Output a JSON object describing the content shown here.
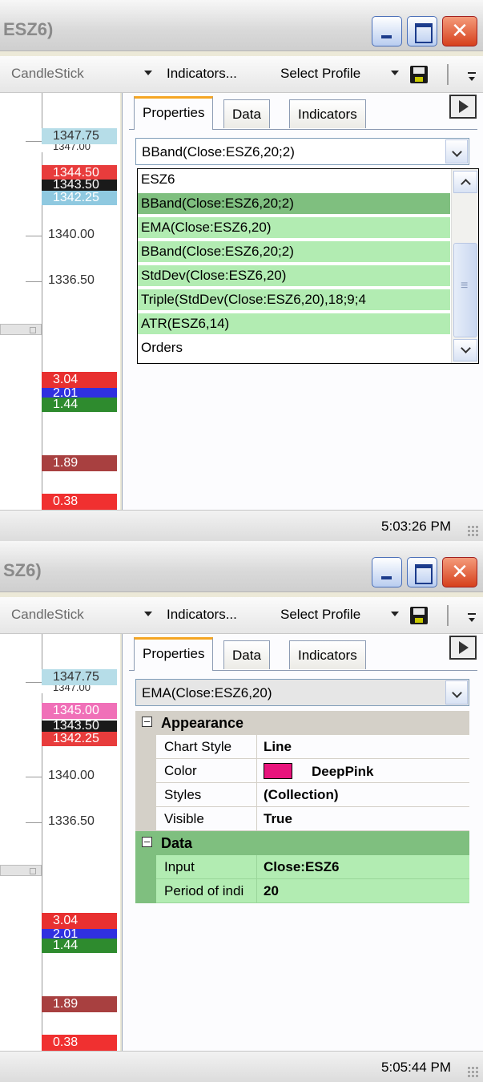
{
  "panels": [
    {
      "title": "SZ6)",
      "title_visible_prefix": "ESZ6)",
      "toolbar": {
        "chart_style": "CandleStick",
        "indicators": "Indicators...",
        "select_profile": "Select Profile"
      },
      "axis": {
        "top_box_back": "1347.00",
        "boxes": [
          {
            "text": "1347.75",
            "color": "#b6dde8"
          },
          {
            "text": "1344.50",
            "color": "#e83c3c"
          },
          {
            "text": "1343.50",
            "color": "#1a1a1a"
          },
          {
            "text": "1342.25",
            "color": "#8fc9e0"
          }
        ],
        "labels": [
          "1340.00",
          "1336.50"
        ],
        "indicator_boxes": [
          {
            "text": "3.04",
            "color": "#e83030"
          },
          {
            "text": "2.01",
            "color": "#3030e0"
          },
          {
            "text": "1.44",
            "color": "#2e8b2e"
          },
          {
            "text": "1.89",
            "color": "#a84040"
          },
          {
            "text": "0.38",
            "color": "#f03030"
          }
        ]
      },
      "tabs": [
        "Properties",
        "Data",
        "Indicators"
      ],
      "combo_value": "BBand(Close:ESZ6,20;2)",
      "dropdown_items": [
        "ESZ6",
        "BBand(Close:ESZ6,20;2)",
        "EMA(Close:ESZ6,20)",
        "BBand(Close:ESZ6,20;2)",
        "StdDev(Close:ESZ6,20)",
        "Triple(StdDev(Close:ESZ6,20),18;9;4",
        "ATR(ESZ6,14)",
        "Orders"
      ],
      "status_time": "5:03:26 PM"
    },
    {
      "title": "SZ6)",
      "toolbar": {
        "chart_style": "CandleStick",
        "indicators": "Indicators...",
        "select_profile": "Select Profile"
      },
      "axis": {
        "top_box_back": "1347.00",
        "boxes": [
          {
            "text": "1347.75",
            "color": "#b6dde8"
          },
          {
            "text": "1345.00",
            "color": "#f070b8"
          },
          {
            "text": "1343.50",
            "color": "#1a1a1a"
          },
          {
            "text": "1342.25",
            "color": "#e83c3c"
          }
        ],
        "labels": [
          "1340.00",
          "1336.50"
        ],
        "indicator_boxes": [
          {
            "text": "3.04",
            "color": "#e83030"
          },
          {
            "text": "2.01",
            "color": "#3030e0"
          },
          {
            "text": "1.44",
            "color": "#2e8b2e"
          },
          {
            "text": "1.89",
            "color": "#a84040"
          },
          {
            "text": "0.38",
            "color": "#f03030"
          }
        ]
      },
      "tabs": [
        "Properties",
        "Data",
        "Indicators"
      ],
      "combo_value": "EMA(Close:ESZ6,20)",
      "property_grid": {
        "appearance": {
          "label": "Appearance",
          "rows": [
            {
              "name": "Chart Style",
              "value": "Line"
            },
            {
              "name": "Color",
              "value": "DeepPink",
              "swatch": "#e8147c"
            },
            {
              "name": "Styles",
              "value": "(Collection)"
            },
            {
              "name": "Visible",
              "value": "True"
            }
          ]
        },
        "data": {
          "label": "Data",
          "rows": [
            {
              "name": "Input",
              "value": "Close:ESZ6"
            },
            {
              "name": "Period of indi",
              "value": "20"
            }
          ]
        }
      },
      "status_time": "5:05:44 PM"
    }
  ]
}
